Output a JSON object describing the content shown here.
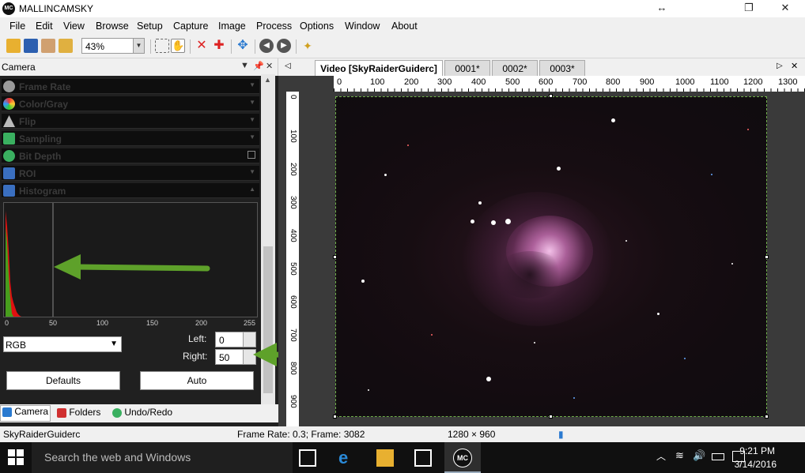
{
  "app": {
    "title": "MALLINCAMSKY",
    "logo_text": "MC"
  },
  "window_controls": {
    "resize": "↔",
    "restore": "❐",
    "close": "✕"
  },
  "menu": [
    "File",
    "Edit",
    "View",
    "Browse",
    "Setup",
    "Capture",
    "Image",
    "Process",
    "Options",
    "Window",
    "About"
  ],
  "toolbar": {
    "zoom": "43%",
    "icons": [
      "open-icon",
      "save-icon",
      "edit-icon",
      "folder-icon",
      "select-icon",
      "hand-icon",
      "cross-red-icon",
      "crosshair-red-icon",
      "move-icon",
      "back-icon",
      "forward-icon",
      "sparkle-icon"
    ]
  },
  "panel": {
    "title": "Camera",
    "sections": [
      {
        "label": "Frame Rate",
        "icon": "clock-icon",
        "color": "#9a9a9a"
      },
      {
        "label": "Color/Gray",
        "icon": "color-wheel-icon",
        "color": "#e8a030"
      },
      {
        "label": "Flip",
        "icon": "flip-icon",
        "color": "#bbb"
      },
      {
        "label": "Sampling",
        "icon": "sampling-icon",
        "color": "#3ab060"
      },
      {
        "label": "Bit Depth",
        "icon": "bit-depth-icon",
        "color": "#3ab060"
      },
      {
        "label": "ROI",
        "icon": "roi-icon",
        "color": "#3a6fc0"
      },
      {
        "label": "Histogram",
        "icon": "histogram-icon",
        "color": "#3a6fc0"
      }
    ],
    "histogram": {
      "ticks": [
        "0",
        "50",
        "100",
        "150",
        "200",
        "255"
      ],
      "left_value": 0,
      "right_value": 50
    },
    "channel": "RGB",
    "left_label": "Left:",
    "left_value": "0",
    "right_label": "Right:",
    "right_value": "50",
    "defaults_button": "Defaults",
    "auto_button": "Auto",
    "bottom_tabs": [
      "Camera",
      "Folders",
      "Undo/Redo"
    ]
  },
  "doc": {
    "tabs": [
      "Video [SkyRaiderGuiderc]",
      "0001*",
      "0002*",
      "0003*"
    ],
    "ruler_top": [
      "0",
      "100",
      "200",
      "300",
      "400",
      "500",
      "600",
      "700",
      "800",
      "900",
      "1000",
      "1100",
      "1200",
      "1300"
    ],
    "ruler_left": [
      "0",
      "100",
      "200",
      "300",
      "400",
      "500",
      "600",
      "700",
      "800",
      "900"
    ]
  },
  "status": {
    "camera": "SkyRaiderGuiderc",
    "frame": "Frame Rate: 0.3; Frame: 3082",
    "size": "1280 × 960"
  },
  "taskbar": {
    "search": "Search the web and Windows",
    "time": "9:21 PM",
    "date": "3/14/2016",
    "app_label": "MC"
  },
  "annotation_color": "#5ea12a"
}
